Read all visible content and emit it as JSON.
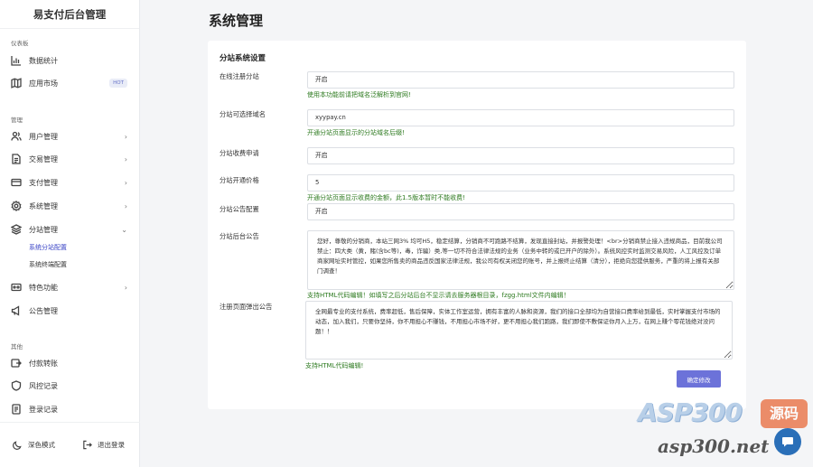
{
  "brand": "易支付后台管理",
  "sidebar": {
    "sections": [
      "仪表板",
      "管理",
      "其他"
    ],
    "items": [
      {
        "label": "数据统计",
        "icon": "bar-chart-icon"
      },
      {
        "label": "应用市场",
        "icon": "map-icon",
        "badge": "HOT"
      },
      {
        "label": "用户管理",
        "icon": "users-icon",
        "chevron": "›"
      },
      {
        "label": "交易管理",
        "icon": "document-icon",
        "chevron": "›"
      },
      {
        "label": "支付管理",
        "icon": "ticket-icon",
        "chevron": "›"
      },
      {
        "label": "系统管理",
        "icon": "gear-icon",
        "chevron": "›"
      },
      {
        "label": "分站管理",
        "icon": "layers-icon",
        "chevron": "⌄"
      },
      {
        "label": "特色功能",
        "icon": "feature-icon",
        "chevron": "›"
      },
      {
        "label": "公告管理",
        "icon": "megaphone-icon"
      },
      {
        "label": "付款转账",
        "icon": "transfer-icon"
      },
      {
        "label": "风控记录",
        "icon": "shield-icon"
      },
      {
        "label": "登录记录",
        "icon": "log-icon"
      }
    ],
    "subitems": [
      "系统分站配置",
      "系统终端配置"
    ],
    "footer": {
      "dark_mode": "深色模式",
      "logout": "退出登录"
    }
  },
  "page_title": "系统管理",
  "card": {
    "title": "分站系统设置",
    "fields": [
      {
        "label": "在线注册分站",
        "value": "开启",
        "hint": "使用本功能前请把域名泛解析到官网!"
      },
      {
        "label": "分站可选择域名",
        "value": "xyypay.cn",
        "hint": "开通分站页面显示的分站域名后缀!"
      },
      {
        "label": "分站收费申请",
        "value": "开启",
        "hint": ""
      },
      {
        "label": "分站开通价格",
        "value": "5",
        "hint": "开通分站页面显示收费的金额，此1.5版本暂时不能收费!"
      },
      {
        "label": "分站公告配置",
        "value": "开启",
        "hint": ""
      }
    ],
    "notice": {
      "label": "分站后台公告",
      "value": "您好，尊敬的分销商，本站三网3% 均可H5，稳定结算，分销商不可跑路不结算，发现直接封站，并报警处理！<br>分销商禁止接入违规商品，目前我公司禁止：四大类（黄，赌(含bc等)，毒，诈骗）类,等一切不符合法律法规的业务（业务中转的或已开户的除外）。系统风控实时监测交易风险，人工风控及订单商家网址实时管控，如果您所售卖的商品违反国家法律法规，我公司有权关闭您的账号，并上报终止结算（清分），拒绝向您提供服务，严重的将上报有关部门调查！",
      "hint": "支持HTML代码编辑！如填写之后分站后台不显示请去服务器根目录，fzgg.html文件内编辑！"
    },
    "popup": {
      "label": "注册页面弹出公告",
      "value": "全网最专业的支付系统，费率超低，售后保障，实体工作室运营，拥有丰富的人脉和资源，我们的接口全部均为自营接口费率给到最低，实时掌握支付市场的动态，加入我们，只要你坚持，你不用担心不赚钱，不用担心市场不好，更不用担心我们跑路，我们即使不敷保证你月入上万，在网上赚个零花钱绝对没问题！！",
      "hint": "支持HTML代码编辑!"
    },
    "submit": "确定修改"
  },
  "watermark": {
    "top": "ASP300",
    "tag": "源码",
    "bottom": "asp300.net"
  }
}
